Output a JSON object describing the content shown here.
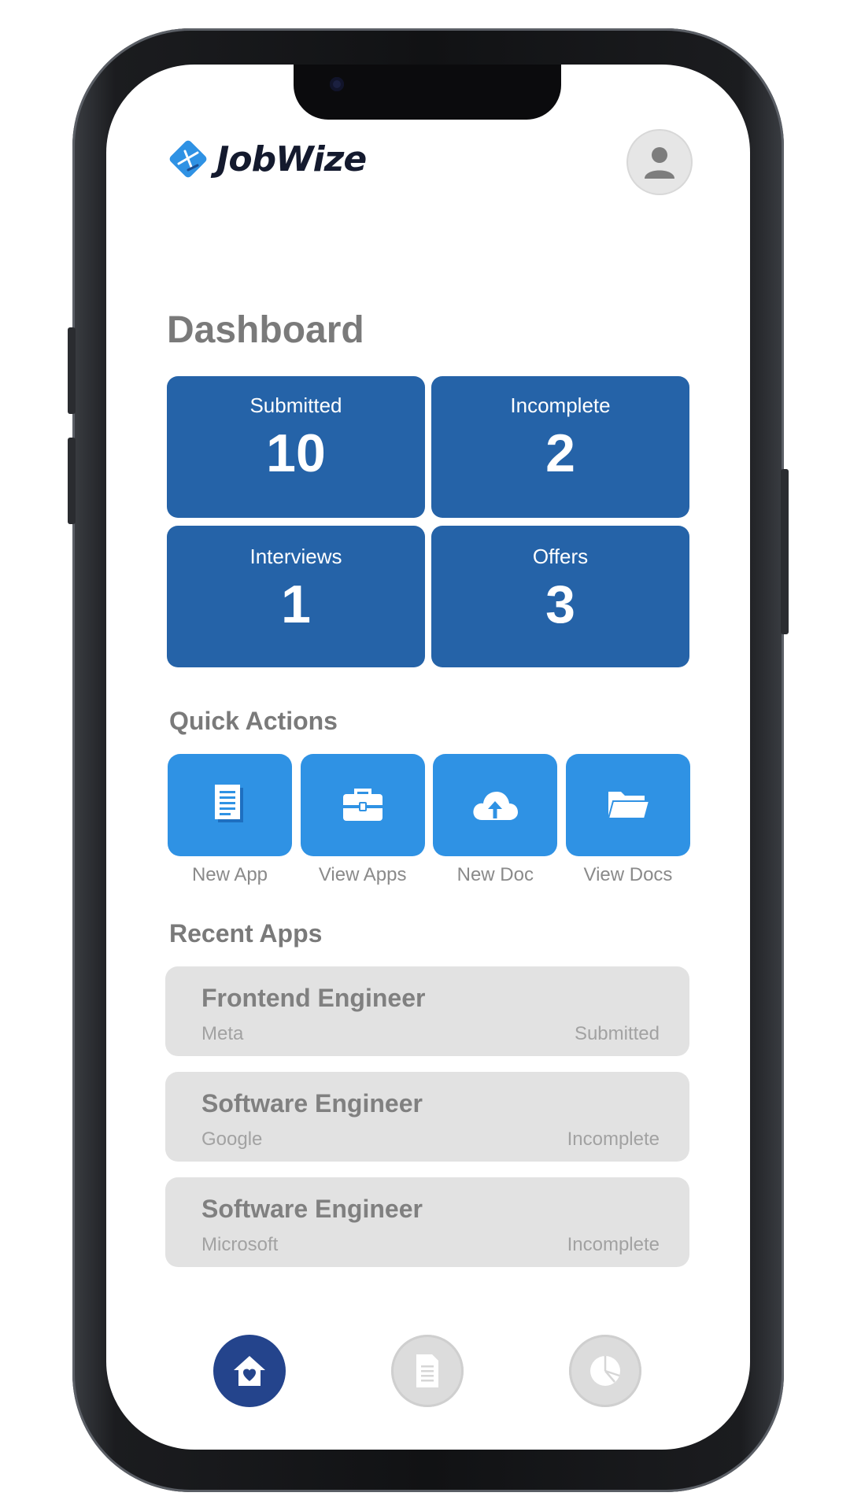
{
  "app": {
    "brand_name": "JobWize"
  },
  "header": {
    "avatar_icon": "user-avatar-icon"
  },
  "dashboard": {
    "title": "Dashboard",
    "stats": [
      {
        "label": "Submitted",
        "value": "10"
      },
      {
        "label": "Incomplete",
        "value": "2"
      },
      {
        "label": "Interviews",
        "value": "1"
      },
      {
        "label": "Offers",
        "value": "3"
      }
    ]
  },
  "quick_actions": {
    "title": "Quick Actions",
    "items": [
      {
        "label": "New App",
        "icon": "document-icon"
      },
      {
        "label": "View Apps",
        "icon": "briefcase-icon"
      },
      {
        "label": "New Doc",
        "icon": "cloud-upload-icon"
      },
      {
        "label": "View Docs",
        "icon": "folder-icon"
      }
    ]
  },
  "recent_apps": {
    "title": "Recent Apps",
    "items": [
      {
        "title": "Frontend Engineer",
        "company": "Meta",
        "status": "Submitted"
      },
      {
        "title": "Software Engineer",
        "company": "Google",
        "status": "Incomplete"
      },
      {
        "title": "Software Engineer",
        "company": "Microsoft",
        "status": "Incomplete"
      }
    ]
  },
  "bottom_nav": {
    "items": [
      {
        "icon": "home-icon",
        "active": true
      },
      {
        "icon": "document-icon",
        "active": false
      },
      {
        "icon": "pie-chart-icon",
        "active": false
      }
    ]
  },
  "colors": {
    "stat_tile": "#2563a8",
    "action_button": "#2f92e4",
    "nav_active": "#24448c",
    "card_background": "#e2e2e2",
    "heading_gray": "#7a7a7a"
  }
}
